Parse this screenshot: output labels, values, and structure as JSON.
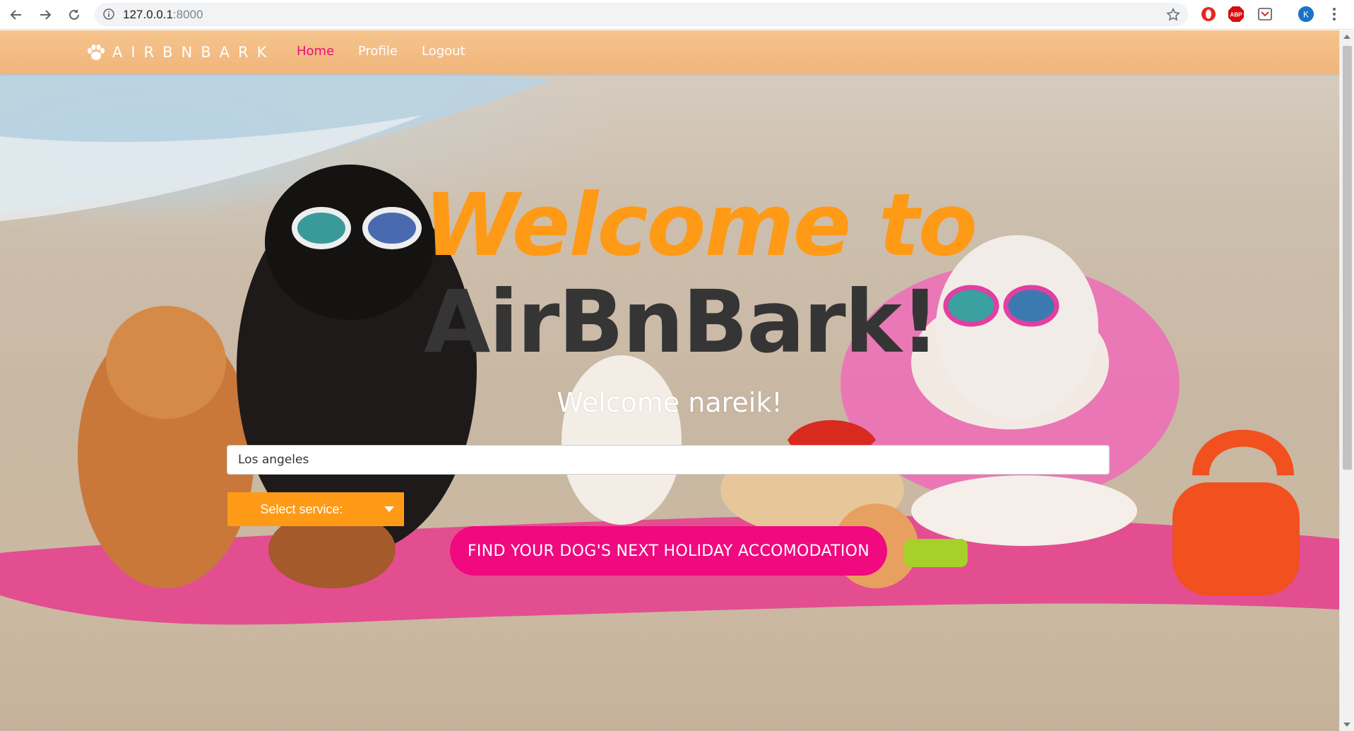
{
  "browser": {
    "url_host": "127.0.0.1",
    "url_port": ":8000",
    "profile_initial": "K",
    "extensions": [
      "opera-icon",
      "abp-icon",
      "pocket-icon"
    ],
    "abp_label": "ABP"
  },
  "site_nav": {
    "brand": "AIRBNBARK",
    "links": [
      "Home",
      "Profile",
      "Logout"
    ],
    "active_link": "Home"
  },
  "hero": {
    "line1": "Welcome to",
    "line2": "AirBnBark!",
    "welcome_user": "Welcome nareik!"
  },
  "search": {
    "location_value": "Los angeles",
    "service_select_label": "Select service:",
    "submit_label": "FIND YOUR DOG'S NEXT HOLIDAY ACCOMODATION"
  },
  "colors": {
    "nav_bg": "#f0b57a",
    "accent_orange": "#ff9a17",
    "accent_pink": "#f0097f",
    "heading_dark": "#353535"
  }
}
